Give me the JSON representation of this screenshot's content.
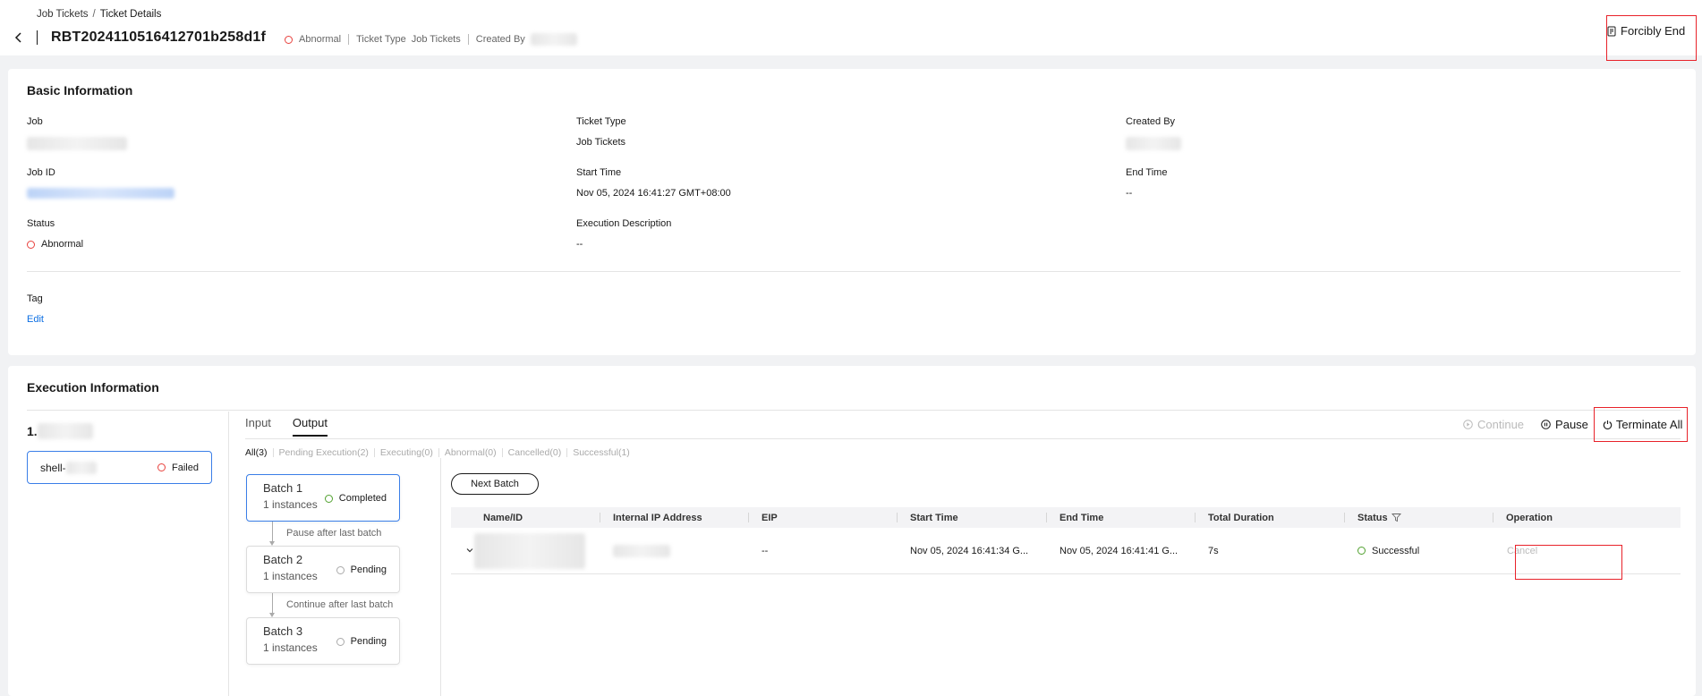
{
  "breadcrumb": {
    "parent": "Job Tickets",
    "separator": "/",
    "current": "Ticket Details"
  },
  "header": {
    "ticket_id": "RBT2024110516412701b258d1f",
    "status": "Abnormal",
    "ticket_type_label": "Ticket Type",
    "ticket_type_value": "Job Tickets",
    "created_by_label": "Created By",
    "forcibly_end": "Forcibly End"
  },
  "basic": {
    "title": "Basic Information",
    "job_label": "Job",
    "ticket_type_label": "Ticket Type",
    "ticket_type_value": "Job Tickets",
    "created_by_label": "Created By",
    "job_id_label": "Job ID",
    "start_time_label": "Start Time",
    "start_time_value": "Nov 05, 2024 16:41:27 GMT+08:00",
    "end_time_label": "End Time",
    "end_time_value": "--",
    "status_label": "Status",
    "status_value": "Abnormal",
    "exec_desc_label": "Execution Description",
    "exec_desc_value": "--",
    "tag_label": "Tag",
    "tag_edit": "Edit"
  },
  "execution": {
    "title": "Execution Information",
    "step_prefix": "1.",
    "task_name_prefix": "shell-",
    "task_status": "Failed",
    "tabs": [
      "Input",
      "Output"
    ],
    "actions": {
      "continue": "Continue",
      "pause": "Pause",
      "terminate_all": "Terminate All"
    },
    "filters": [
      "All(3)",
      "Pending Execution(2)",
      "Executing(0)",
      "Abnormal(0)",
      "Cancelled(0)",
      "Successful(1)"
    ],
    "batches": [
      {
        "name": "Batch 1",
        "instances": "1 instances",
        "status": "Completed"
      },
      {
        "name": "Batch 2",
        "instances": "1 instances",
        "status": "Pending"
      },
      {
        "name": "Batch 3",
        "instances": "1 instances",
        "status": "Pending"
      }
    ],
    "connectors": [
      "Pause after last batch",
      "Continue after last batch"
    ],
    "next_batch": "Next Batch",
    "table": {
      "headers": [
        "Name/ID",
        "Internal IP Address",
        "EIP",
        "Start Time",
        "End Time",
        "Total Duration",
        "Status",
        "Operation"
      ],
      "row": {
        "eip": "--",
        "start_time": "Nov 05, 2024 16:41:34 G...",
        "end_time": "Nov 05, 2024 16:41:41 G...",
        "duration": "7s",
        "status": "Successful",
        "operation": "Cancel"
      }
    }
  },
  "colors": {
    "error": "#e8413d",
    "success": "#50a12e",
    "link": "#0d6fe3",
    "highlight": "#e8222a",
    "selected_border": "#3a7ee8"
  }
}
